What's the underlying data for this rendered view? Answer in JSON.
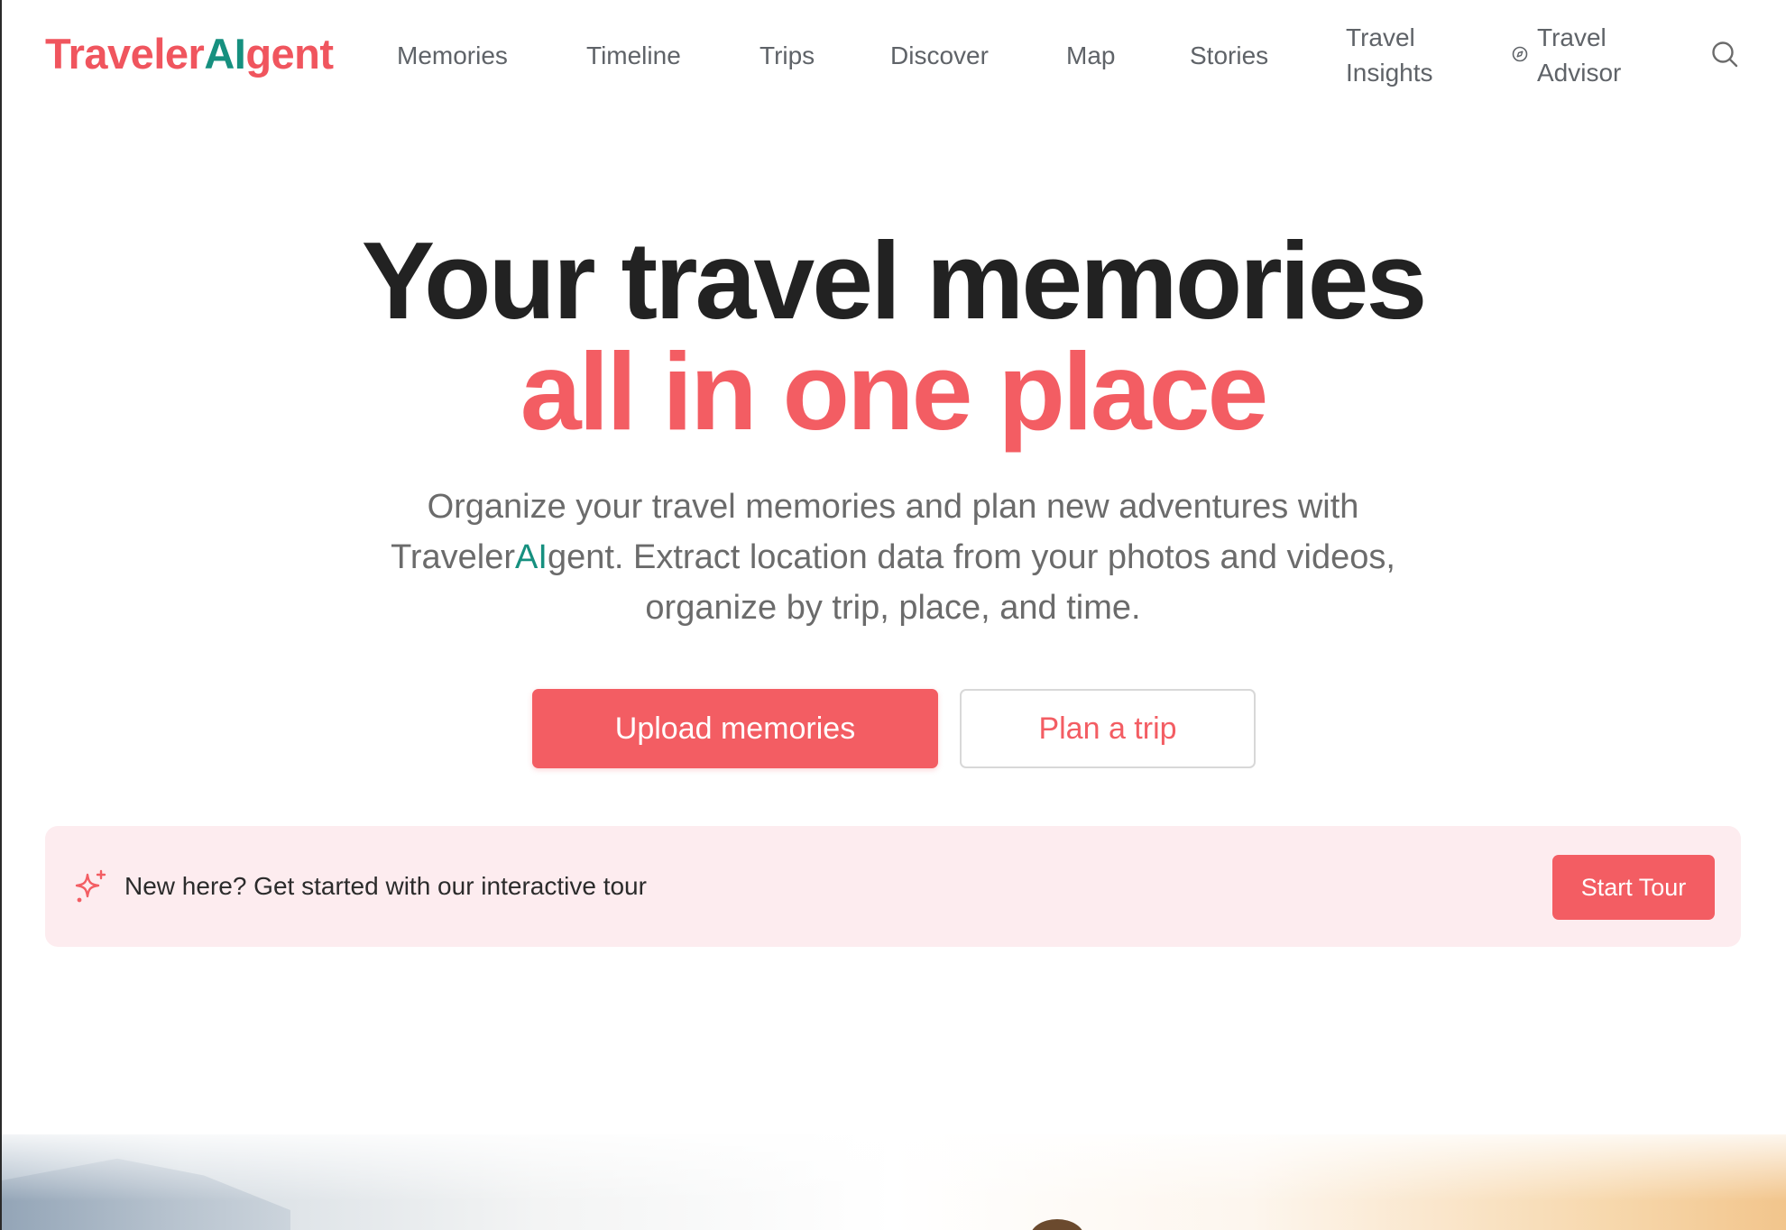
{
  "brand": {
    "name_part1": "Traveler",
    "name_part2": "AI",
    "name_part3": "gent",
    "primary_color": "#f35d63",
    "accent_color": "#16907f"
  },
  "nav": {
    "items": [
      {
        "label": "Memories"
      },
      {
        "label": "Timeline"
      },
      {
        "label": "Trips"
      },
      {
        "label": "Discover"
      },
      {
        "label": "Map"
      },
      {
        "label": "Stories"
      },
      {
        "label": "Travel Insights"
      },
      {
        "label": "Travel Advisor",
        "icon": "compass-icon"
      }
    ],
    "search_icon": "search-icon"
  },
  "hero": {
    "title_line1": "Your travel memories",
    "title_line2": "all in one place",
    "subtitle_part1": "Organize your travel memories and plan new adventures with Traveler",
    "subtitle_ai": "AI",
    "subtitle_part2": "gent. Extract location data from your photos and videos, organize by trip, place, and time.",
    "primary_button": "Upload memories",
    "secondary_button": "Plan a trip"
  },
  "tour": {
    "icon": "sparkles-icon",
    "text": "New here? Get started with our interactive tour",
    "button": "Start Tour"
  }
}
